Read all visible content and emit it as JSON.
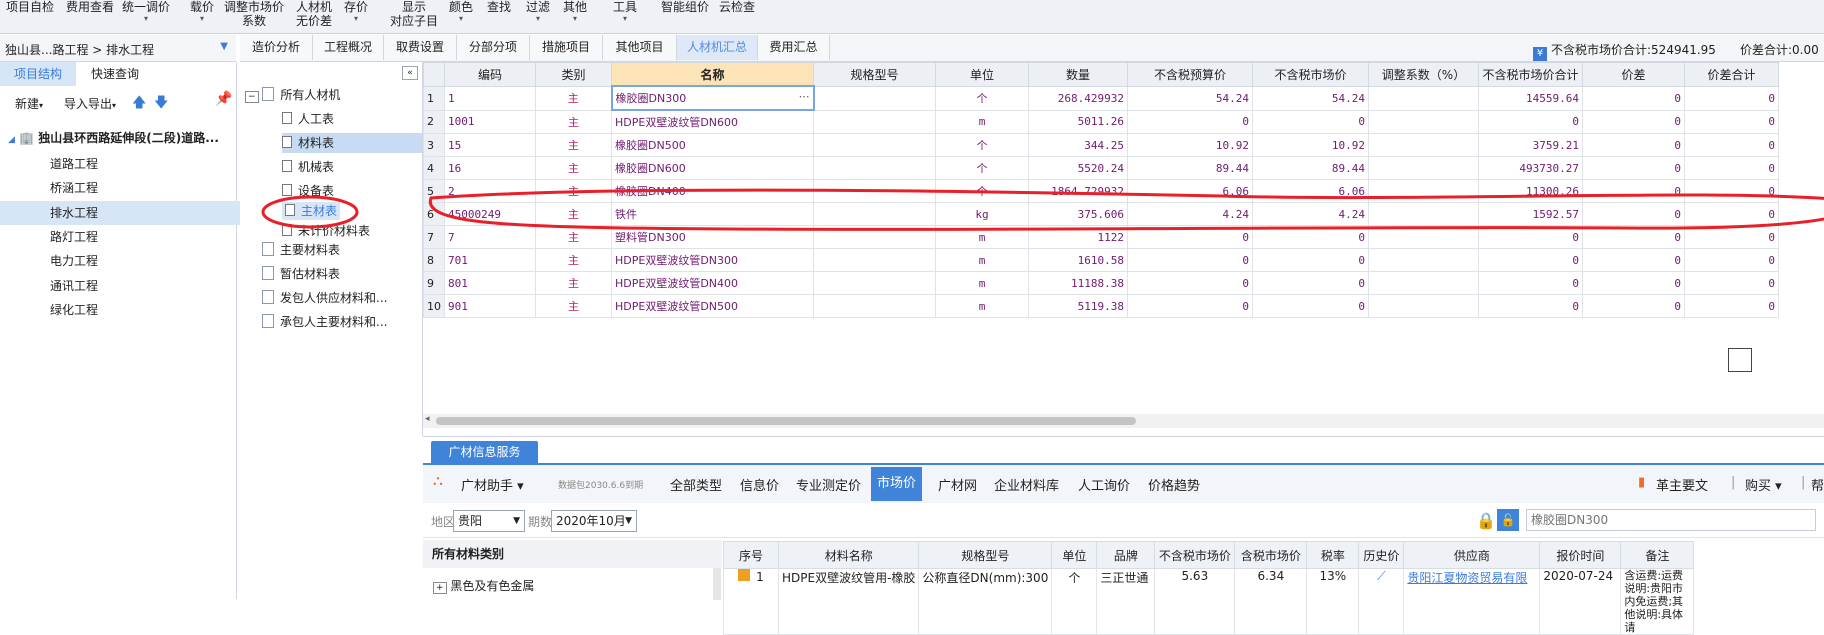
{
  "toolbar": {
    "items": [
      {
        "line1": "项目自检",
        "line2": ""
      },
      {
        "line1": "费用查看",
        "line2": ""
      },
      {
        "line1": "统一调价",
        "line2": ""
      },
      {
        "line1": "载价",
        "line2": ""
      },
      {
        "line1": "调整市场价",
        "line2": "系数"
      },
      {
        "line1": "人材机",
        "line2": "无价差"
      },
      {
        "line1": "存价",
        "line2": ""
      },
      {
        "line1": "显示",
        "line2": "对应子目"
      },
      {
        "line1": "颜色",
        "line2": ""
      },
      {
        "line1": "查找",
        "line2": ""
      },
      {
        "line1": "过滤",
        "line2": ""
      },
      {
        "line1": "其他",
        "line2": ""
      },
      {
        "line1": "工具",
        "line2": ""
      },
      {
        "line1": "智能组价",
        "line2": ""
      },
      {
        "line1": "云检查",
        "line2": ""
      }
    ]
  },
  "breadcrumb": "独山县...路工程 > 排水工程",
  "tabs": [
    "造价分析",
    "工程概况",
    "取费设置",
    "分部分项",
    "措施项目",
    "其他项目",
    "人材机汇总",
    "费用汇总"
  ],
  "active_tab": "人材机汇总",
  "summary": {
    "tax_excl_total": "不含税市场价合计:524941.95",
    "diff_total": "价差合计:0.00"
  },
  "left_panel": {
    "tabs": [
      "项目结构",
      "快速查询"
    ],
    "new_label": "新建",
    "import_export_label": "导入导出",
    "project": "独山县环西路延伸段(二段)道路...",
    "units": [
      "道路工程",
      "桥涵工程",
      "排水工程",
      "路灯工程",
      "电力工程",
      "通讯工程",
      "绿化工程"
    ],
    "selected_unit": "排水工程"
  },
  "material_tree": {
    "root": "所有人材机",
    "children": [
      "人工表",
      "材料表",
      "机械表",
      "设备表",
      "主材表",
      "未计价材料表"
    ],
    "others": [
      "主要材料表",
      "暂估材料表",
      "发包人供应材料和...",
      "承包人主要材料和..."
    ]
  },
  "grid": {
    "columns": [
      "编码",
      "类别",
      "名称",
      "规格型号",
      "单位",
      "数量",
      "不含税预算价",
      "不含税市场价",
      "调整系数（%）",
      "不含税市场价合计",
      "价差",
      "价差合计"
    ],
    "rows": [
      {
        "idx": "1",
        "code": "1",
        "cat": "主",
        "name": "橡胶圈DN300",
        "spec": "",
        "unit": "个",
        "qty": "268.429932",
        "budget": "54.24",
        "market": "54.24",
        "adj": "",
        "total": "14559.64",
        "diff": "0",
        "diff_total": "0"
      },
      {
        "idx": "2",
        "code": "1001",
        "cat": "主",
        "name": "HDPE双壁波纹管DN600",
        "spec": "",
        "unit": "m",
        "qty": "5011.26",
        "budget": "0",
        "market": "0",
        "adj": "",
        "total": "0",
        "diff": "0",
        "diff_total": "0"
      },
      {
        "idx": "3",
        "code": "15",
        "cat": "主",
        "name": "橡胶圈DN500",
        "spec": "",
        "unit": "个",
        "qty": "344.25",
        "budget": "10.92",
        "market": "10.92",
        "adj": "",
        "total": "3759.21",
        "diff": "0",
        "diff_total": "0"
      },
      {
        "idx": "4",
        "code": "16",
        "cat": "主",
        "name": "橡胶圈DN600",
        "spec": "",
        "unit": "个",
        "qty": "5520.24",
        "budget": "89.44",
        "market": "89.44",
        "adj": "",
        "total": "493730.27",
        "diff": "0",
        "diff_total": "0"
      },
      {
        "idx": "5",
        "code": "2",
        "cat": "主",
        "name": "橡胶圈DN400",
        "spec": "",
        "unit": "个",
        "qty": "1864.729932",
        "budget": "6.06",
        "market": "6.06",
        "adj": "",
        "total": "11300.26",
        "diff": "0",
        "diff_total": "0"
      },
      {
        "idx": "6",
        "code": "45000249",
        "cat": "主",
        "name": "铁件",
        "spec": "",
        "unit": "kg",
        "qty": "375.606",
        "budget": "4.24",
        "market": "4.24",
        "adj": "",
        "total": "1592.57",
        "diff": "0",
        "diff_total": "0"
      },
      {
        "idx": "7",
        "code": "7",
        "cat": "主",
        "name": "塑料管DN300",
        "spec": "",
        "unit": "m",
        "qty": "1122",
        "budget": "0",
        "market": "0",
        "adj": "",
        "total": "0",
        "diff": "0",
        "diff_total": "0"
      },
      {
        "idx": "8",
        "code": "701",
        "cat": "主",
        "name": "HDPE双壁波纹管DN300",
        "spec": "",
        "unit": "m",
        "qty": "1610.58",
        "budget": "0",
        "market": "0",
        "adj": "",
        "total": "0",
        "diff": "0",
        "diff_total": "0"
      },
      {
        "idx": "9",
        "code": "801",
        "cat": "主",
        "name": "HDPE双壁波纹管DN400",
        "spec": "",
        "unit": "m",
        "qty": "11188.38",
        "budget": "0",
        "market": "0",
        "adj": "",
        "total": "0",
        "diff": "0",
        "diff_total": "0"
      },
      {
        "idx": "10",
        "code": "901",
        "cat": "主",
        "name": "HDPE双壁波纹管DN500",
        "spec": "",
        "unit": "m",
        "qty": "5119.38",
        "budget": "0",
        "market": "0",
        "adj": "",
        "total": "0",
        "diff": "0",
        "diff_total": "0"
      }
    ]
  },
  "bottom": {
    "service_tab": "广材信息服务",
    "assistant": "广材助手",
    "data_pkg": "数据包2030.6.6到期",
    "tabs": [
      "全部类型",
      "信息价",
      "专业测定价",
      "市场价",
      "广材网",
      "企业材料库",
      "人工询价",
      "价格趋势"
    ],
    "active_tab": "市场价",
    "right_links": [
      "革主要文",
      "购买",
      "帮"
    ],
    "region_label": "地区",
    "region_value": "贵阳",
    "period_label": "期数",
    "period_value": "2020年10月",
    "search_placeholder": "橡胶圈DN300",
    "category_title": "所有材料类别",
    "category_first": "黑色及有色金属",
    "columns": [
      "序号",
      "材料名称",
      "规格型号",
      "单位",
      "品牌",
      "不含税市场价",
      "含税市场价",
      "税率",
      "历史价",
      "供应商",
      "报价时间",
      "备注"
    ],
    "row": {
      "idx": "1",
      "name": "HDPE双壁波纹管用-橡胶",
      "spec": "公称直径DN(mm):300",
      "unit": "个",
      "brand": "三正世通",
      "price_ex": "5.63",
      "price_in": "6.34",
      "tax": "13%",
      "supplier": "贵阳江夏物资贸易有限",
      "time": "2020-07-24",
      "note": "含运费:运费说明:贵阳市内免运费;其他说明:具体请"
    }
  },
  "colors": {
    "accent": "#3f84d9",
    "annotation": "#e8202a",
    "row_text": "#701a70"
  }
}
